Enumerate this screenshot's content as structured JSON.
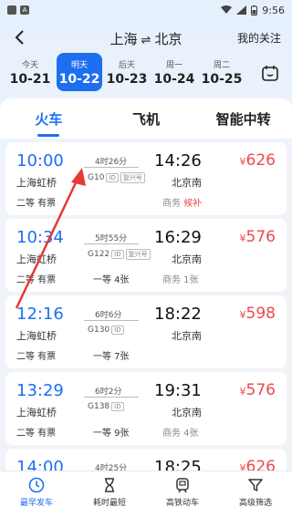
{
  "status": {
    "time": "9:56",
    "icon_left": "A"
  },
  "header": {
    "from": "上海",
    "swap": "⇌",
    "to": "北京",
    "follow": "我的关注"
  },
  "dates": [
    {
      "week": "今天",
      "date": "10-21",
      "active": false
    },
    {
      "week": "明天",
      "date": "10-22",
      "active": true
    },
    {
      "week": "后天",
      "date": "10-23",
      "active": false
    },
    {
      "week": "周一",
      "date": "10-24",
      "active": false
    },
    {
      "week": "周二",
      "date": "10-25",
      "active": false
    }
  ],
  "modes": [
    "火车",
    "飞机",
    "智能中转"
  ],
  "trains": [
    {
      "dep": "10:00",
      "from": "上海虹桥",
      "duration": "4时26分",
      "no": "G10",
      "tags": [
        "复兴号"
      ],
      "arr": "14:26",
      "to": "北京南",
      "seat1": "二等 有票",
      "seat2": "",
      "seat3_label": "商务",
      "seat3_value": "候补",
      "price": "626"
    },
    {
      "dep": "10:34",
      "from": "上海虹桥",
      "duration": "5时55分",
      "no": "G122",
      "tags": [
        "复兴号"
      ],
      "arr": "16:29",
      "to": "北京南",
      "seat1": "二等 有票",
      "seat2": "一等 4张",
      "seat3_label": "商务 1张",
      "seat3_value": "",
      "price": "576"
    },
    {
      "dep": "12:16",
      "from": "上海虹桥",
      "duration": "6时6分",
      "no": "G130",
      "tags": [],
      "arr": "18:22",
      "to": "北京南",
      "seat1": "二等 有票",
      "seat2": "一等 7张",
      "seat3_label": "",
      "seat3_value": "",
      "price": "598"
    },
    {
      "dep": "13:29",
      "from": "上海虹桥",
      "duration": "6时2分",
      "no": "G138",
      "tags": [],
      "arr": "19:31",
      "to": "北京南",
      "seat1": "二等 有票",
      "seat2": "一等 9张",
      "seat3_label": "商务 4张",
      "seat3_value": "",
      "price": "576"
    },
    {
      "dep": "14:00",
      "from": "",
      "duration": "4时25分",
      "no": "",
      "tags": [],
      "arr": "18:25",
      "to": "",
      "seat1": "",
      "seat2": "",
      "seat3_label": "",
      "seat3_value": "",
      "price": "626"
    }
  ],
  "currency": "¥",
  "bottom_nav": [
    {
      "label": "最早发车",
      "icon": "clock-icon",
      "active": true
    },
    {
      "label": "耗时最短",
      "icon": "hourglass-icon",
      "active": false
    },
    {
      "label": "高铁动车",
      "icon": "train-icon",
      "active": false
    },
    {
      "label": "高级筛选",
      "icon": "filter-icon",
      "active": false
    }
  ],
  "colors": {
    "accent": "#1e6ff0",
    "price": "#f04848",
    "annotation_arrow": "#e53935"
  }
}
